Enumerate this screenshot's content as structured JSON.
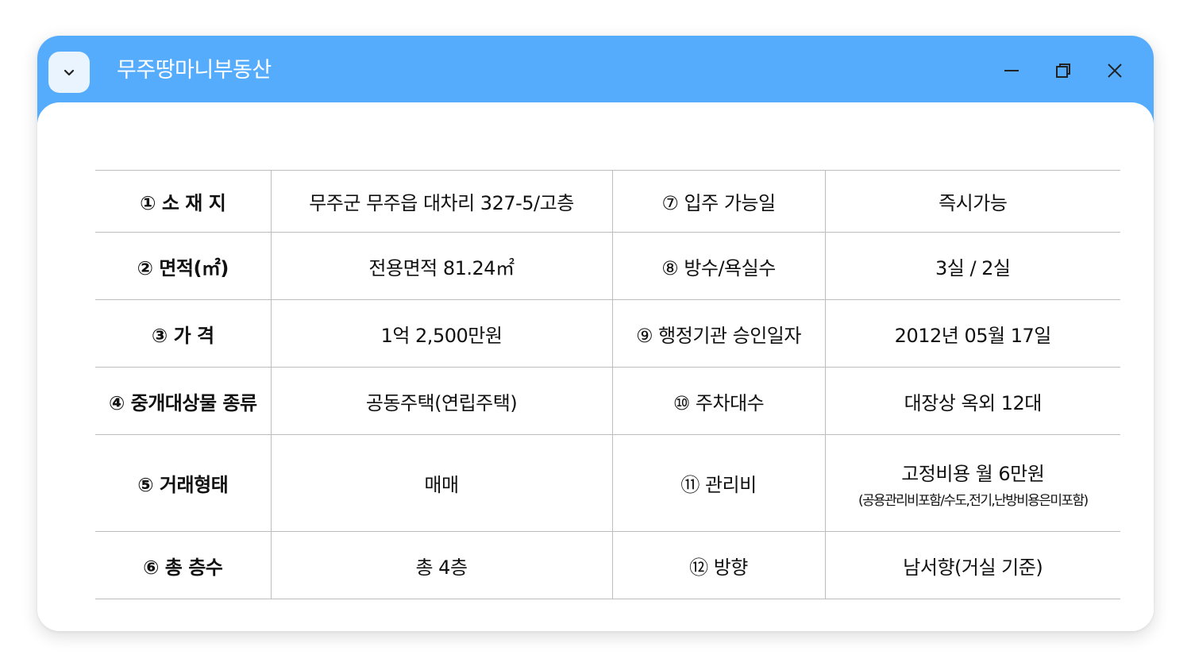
{
  "window": {
    "title": "무주땅마니부동산",
    "colors": {
      "titlebar": "#55acfd",
      "menu_button_bg": "#eaf4ff",
      "table_border": "#bdbdbd"
    },
    "icons": [
      "chevron-down-icon",
      "minimize-icon",
      "restore-icon",
      "close-icon"
    ]
  },
  "table": {
    "rows": [
      {
        "label1": "① 소 재 지",
        "value1": "무주군 무주읍 대차리 327-5/고층",
        "label2": "⑦ 입주 가능일",
        "value2": "즉시가능"
      },
      {
        "label1": "② 면적(㎡)",
        "value1": "전용면적 81.24㎡",
        "label2": "⑧ 방수/욕실수",
        "value2": "3실 / 2실"
      },
      {
        "label1": "③ 가 격",
        "value1": "1억 2,500만원",
        "label2": "⑨ 행정기관 승인일자",
        "value2": "2012년 05월 17일"
      },
      {
        "label1": "④ 중개대상물 종류",
        "value1": "공동주택(연립주택)",
        "label2": "⑩ 주차대수",
        "value2": "대장상 옥외 12대"
      },
      {
        "label1": "⑤ 거래형태",
        "value1": "매매",
        "label2": "⑪ 관리비",
        "value2": "고정비용 월 6만원",
        "value2_sub": "(공용관리비포함/수도,전기,난방비용은미포함)"
      },
      {
        "label1": "⑥  총 층수",
        "value1": "총 4층",
        "label2": "⑫ 방향",
        "value2": "남서향(거실 기준)"
      }
    ]
  }
}
